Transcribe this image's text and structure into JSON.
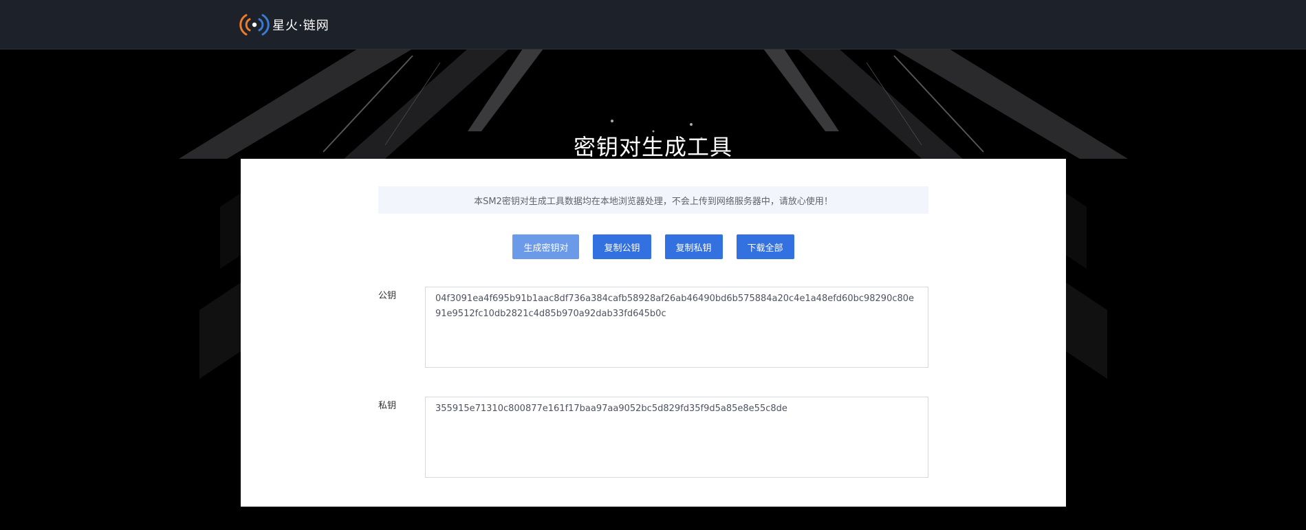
{
  "header": {
    "logo_text": "星火·链网",
    "logo_icon": "broadcast-signal-icon"
  },
  "hero": {
    "title": "密钥对生成工具"
  },
  "notice": {
    "text": "本SM2密钥对生成工具数据均在本地浏览器处理，不会上传到网络服务器中，请放心使用！"
  },
  "buttons": [
    {
      "label": "生成密钥对"
    },
    {
      "label": "复制公钥"
    },
    {
      "label": "复制私钥"
    },
    {
      "label": "下载全部"
    }
  ],
  "public_key": {
    "label": "公钥",
    "value": "04f3091ea4f695b91b1aac8df736a384cafb58928af26ab46490bd6b575884a20c4e1a48efd60bc98290c80e91e9512fc10db2821c4d85b970a92dab33fd645b0c"
  },
  "private_key": {
    "label": "私钥",
    "value": "355915e71310c800877e161f17baa97aa9052bc5d829fd35f9d5a85e8e55c8de"
  },
  "colors": {
    "topbar": "#1d2129",
    "button": "#3370e0",
    "button_light": "#6b9ae8",
    "logo_orange": "#f07c2a",
    "logo_blue": "#3a7bd5"
  }
}
